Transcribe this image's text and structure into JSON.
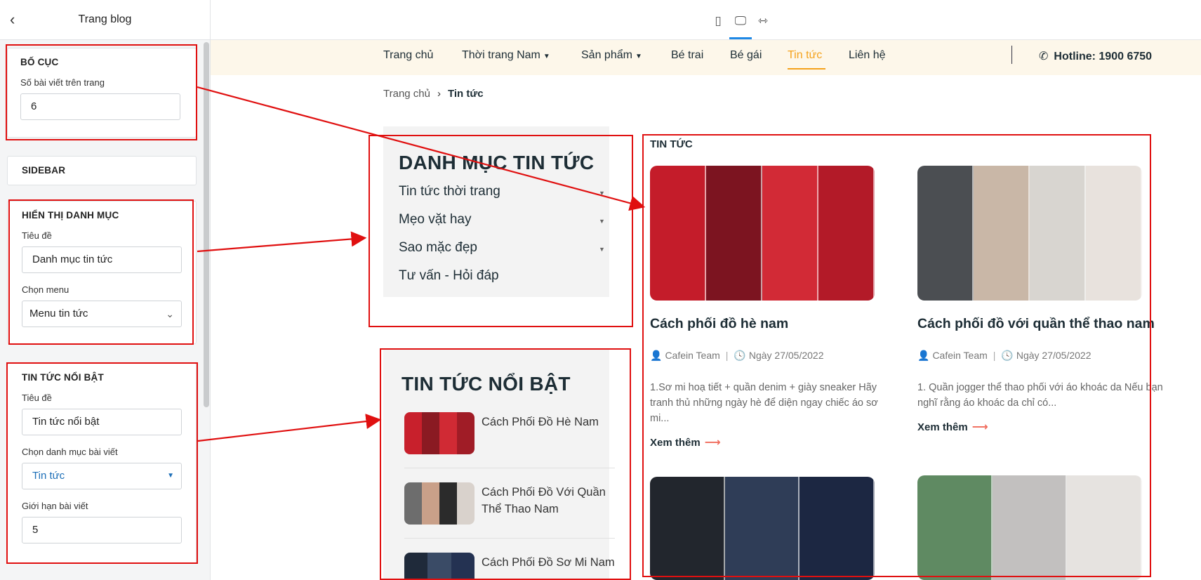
{
  "panel": {
    "title": "Trang blog",
    "layout": {
      "heading": "BỐ CỤC",
      "posts_label": "Số bài viết trên trang",
      "posts_value": "6"
    },
    "sidebar": {
      "heading": "SIDEBAR"
    },
    "category": {
      "heading": "HIỂN THỊ DANH MỤC",
      "title_label": "Tiêu đề",
      "title_value": "Danh mục tin tức",
      "menu_label": "Chọn menu",
      "menu_value": "Menu tin tức"
    },
    "featured": {
      "heading": "TIN TỨC NỔI BẬT",
      "title_label": "Tiêu đề",
      "title_value": "Tin tức nổi bật",
      "cat_label": "Chọn danh mục bài viết",
      "cat_value": "Tin tức",
      "limit_label": "Giới hạn bài viết",
      "limit_value": "5"
    }
  },
  "nav": {
    "items": [
      "Trang chủ",
      "Thời trang Nam",
      "Sản phẩm",
      "Bé trai",
      "Bé gái",
      "Tin tức",
      "Liên hệ"
    ],
    "hotline_label": "Hotline:",
    "hotline_number": "1900 6750"
  },
  "breadcrumb": {
    "home": "Trang chủ",
    "current": "Tin tức"
  },
  "categories_box": {
    "title": "DANH MỤC TIN TỨC",
    "items": [
      "Tin tức thời trang",
      "Mẹo vặt hay",
      "Sao mặc đẹp",
      "Tư vấn - Hỏi đáp"
    ]
  },
  "featured_box": {
    "title": "TIN TỨC NỔI BẬT",
    "items": [
      "Cách Phối Đồ Hè Nam",
      "Cách Phối Đồ Với Quần Thể Thao Nam",
      "Cách Phối Đồ Sơ Mi Nam"
    ]
  },
  "news": {
    "label": "TIN TỨC",
    "posts": [
      {
        "title": "Cách phối đồ hè nam",
        "author": "Cafein Team",
        "date": "Ngày 27/05/2022",
        "excerpt": "1.Sơ mi hoạ tiết + quần denim + giày sneaker Hãy tranh thủ những ngày hè để diện ngay chiếc áo sơ mi...",
        "more": "Xem thêm"
      },
      {
        "title": "Cách phối đồ với quần thể thao nam",
        "author": "Cafein Team",
        "date": "Ngày 27/05/2022",
        "excerpt": "1. Quần jogger thể thao phối với áo khoác da Nếu bạn nghĩ rằng áo khoác da chỉ có...",
        "more": "Xem thêm"
      }
    ]
  },
  "colors": {
    "accent": "#f4a21c",
    "annotation": "#e01010",
    "nav_bg": "#fdf7ea",
    "link_blue": "#1d6fb8"
  }
}
